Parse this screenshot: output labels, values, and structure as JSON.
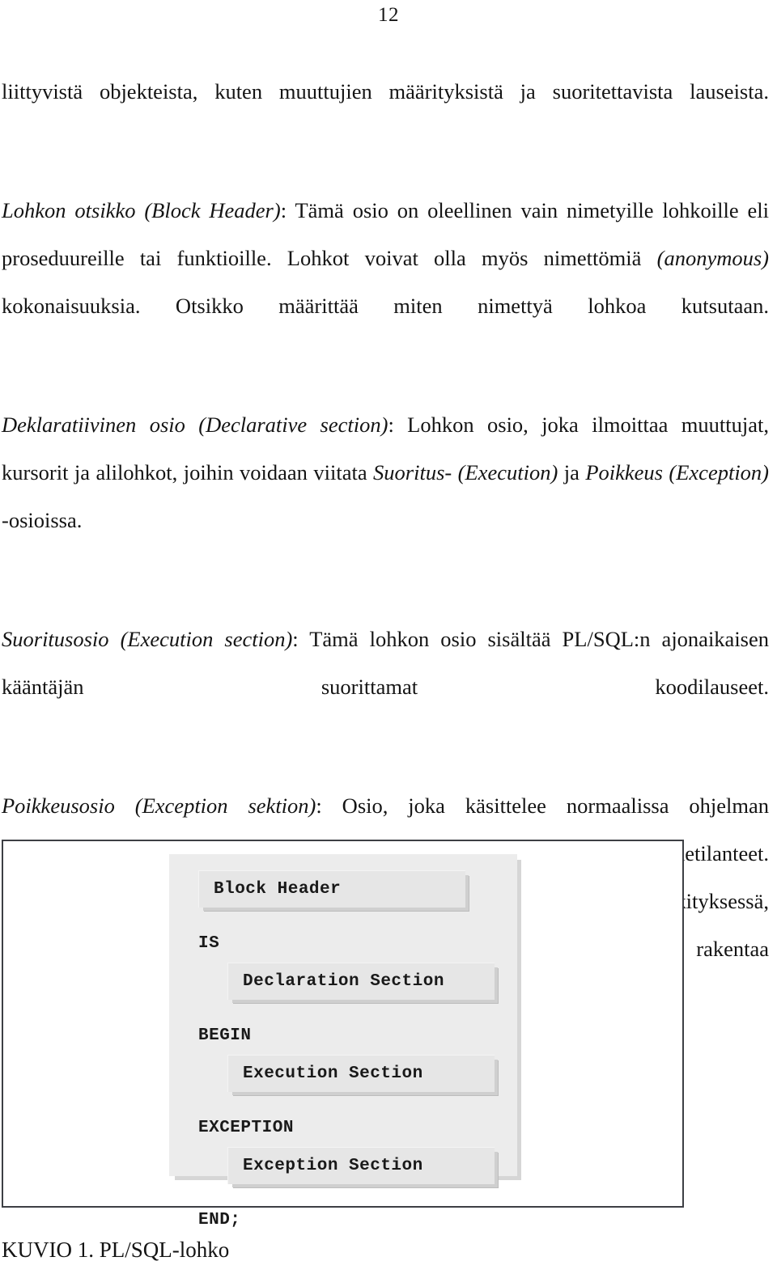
{
  "page": {
    "number": "12"
  },
  "body": {
    "paragraphs": [
      {
        "id": "intro-continuation",
        "segments": [
          {
            "style": "normal",
            "text": "liittyvistä objekteista, kuten muuttujien määrityksistä ja suoritettavista lauseista."
          }
        ]
      },
      {
        "id": "block-header",
        "segments": [
          {
            "style": "italic",
            "text": "Lohkon otsikko (Block Header)"
          },
          {
            "style": "normal",
            "text": ": Tämä osio on oleellinen vain nimetyille lohkoille eli proseduureille tai funktioille. Lohkot voivat olla myös nimettömiä "
          },
          {
            "style": "italic",
            "text": "(anonymous)"
          },
          {
            "style": "normal",
            "text": " kokonaisuuksia. Otsikko määrittää miten nimettyä lohkoa kutsutaan."
          }
        ]
      },
      {
        "id": "declarative-section",
        "segments": [
          {
            "style": "italic",
            "text": "Deklaratiivinen osio (Declarative section)"
          },
          {
            "style": "normal",
            "text": ": Lohkon osio, joka ilmoittaa muuttujat, kursorit ja alilohkot, joihin voidaan viitata "
          },
          {
            "style": "italic",
            "text": "Suoritus- (Execution)"
          },
          {
            "style": "normal",
            "text": " ja "
          },
          {
            "style": "italic",
            "text": "Poikkeus (Exception)"
          },
          {
            "style": "normal",
            "text": " -osioissa."
          }
        ]
      },
      {
        "id": "execution-section",
        "segments": [
          {
            "style": "italic",
            "text": "Suoritusosio (Execution section)"
          },
          {
            "style": "normal",
            "text": ": Tämä lohkon osio sisältää PL/SQL:n ajonaikaisen kääntäjän suorittamat koodilauseet."
          }
        ]
      },
      {
        "id": "exception-section",
        "segments": [
          {
            "style": "italic",
            "text": "Poikkeusosio (Exception sektion)"
          },
          {
            "style": "normal",
            "text": ": Osio, joka käsittelee normaalissa ohjelman suorittamisessa mahdollisesti tapahtuvat poikkeukset eli varoitukset ja virhetilanteet. Luonteeltaan tämä osio on tärkeässä asemassa jokaisen PL/SQL-lohkon merkityksessä, koska poikkeuksien käsittelyä voidaan näin paremmin keskittää ja rakentaa tarpeenmukaiseksi."
          }
        ]
      }
    ]
  },
  "figure": {
    "rows": [
      {
        "kind": "chip",
        "indent": "header",
        "label": "Block Header"
      },
      {
        "kind": "keyword",
        "indent": "flush",
        "label": "IS"
      },
      {
        "kind": "chip",
        "indent": "inner",
        "label": "Declaration Section"
      },
      {
        "kind": "keyword",
        "indent": "flush",
        "label": "BEGIN"
      },
      {
        "kind": "chip",
        "indent": "inner",
        "label": "Execution Section"
      },
      {
        "kind": "keyword",
        "indent": "flush",
        "label": "EXCEPTION"
      },
      {
        "kind": "chip",
        "indent": "inner",
        "label": "Exception Section"
      },
      {
        "kind": "keyword",
        "indent": "flush",
        "label": "END;"
      }
    ],
    "colors": {
      "panel_background": "#ececec",
      "chip_background": "#e6e6e6",
      "chip_shadow": "#cfcfcf",
      "border": "#3d3f44"
    }
  },
  "caption": {
    "text": "KUVIO 1. PL/SQL-lohko"
  }
}
